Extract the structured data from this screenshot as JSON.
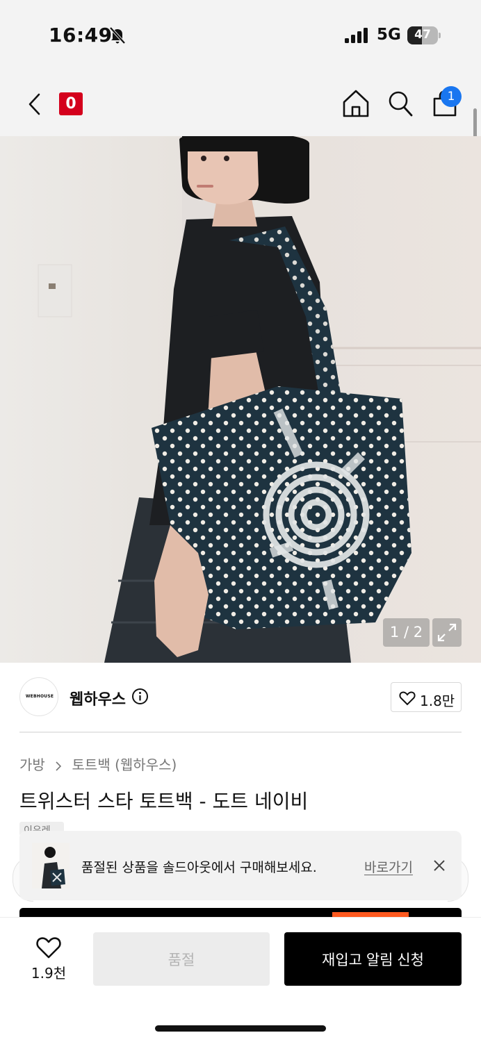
{
  "status_bar": {
    "time": "16:49",
    "network": "5G",
    "battery_level": "47",
    "battery_fraction": 0.47,
    "icons": [
      "bell-off-icon",
      "signal-icon",
      "battery-icon"
    ]
  },
  "nav": {
    "brand_badge": "0",
    "brand_badge_color": "#d4001c",
    "cart_count": "1",
    "cart_badge_color": "#1976f0",
    "icons": [
      "back-arrow-icon",
      "home-icon",
      "search-icon",
      "shopping-bag-icon"
    ]
  },
  "gallery": {
    "counter": "1 / 2",
    "icons": [
      "expand-icon"
    ]
  },
  "brand": {
    "logo_text": "WEBHOUSE",
    "name": "웹하우스",
    "like_count": "1.8만",
    "icons": [
      "info-icon",
      "heart-icon"
    ]
  },
  "breadcrumb": {
    "category": "가방",
    "subcategory": "토트백 (웹하우스)"
  },
  "product": {
    "title": "트위스터 스타 토트백 - 도트 네이비",
    "partial_tag": "이유레"
  },
  "toast": {
    "message": "품절된 상품을 솔드아웃에서 구매해보세요.",
    "link_label": "바로가기",
    "icons": [
      "close-icon"
    ]
  },
  "bottom_bar": {
    "like_count": "1.9천",
    "soldout_label": "품절",
    "restock_label": "재입고 알림 신청",
    "icons": [
      "heart-icon"
    ]
  }
}
